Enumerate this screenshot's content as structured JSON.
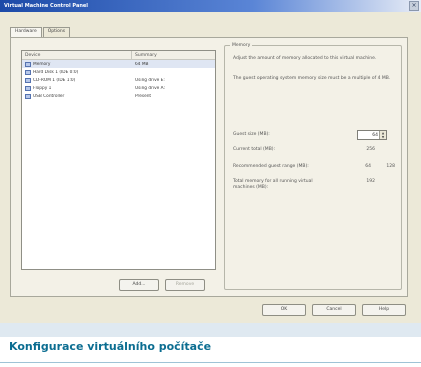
{
  "window": {
    "title": "Virtual Machine Control Panel",
    "close_label": "×"
  },
  "tabs": [
    {
      "label": "Hardware",
      "active": true
    },
    {
      "label": "Options",
      "active": false
    }
  ],
  "device_list": {
    "headers": {
      "device": "Device",
      "summary": "Summary"
    },
    "rows": [
      {
        "device": "Memory",
        "summary": "64 MB",
        "icon": "memory-icon",
        "selected": true
      },
      {
        "device": "Hard Disk 1 (IDE 0:0)",
        "summary": "",
        "icon": "hard-disk-icon",
        "selected": false
      },
      {
        "device": "CD-ROM 1 (IDE 1:0)",
        "summary": "Using drive E:",
        "icon": "cdrom-icon",
        "selected": false
      },
      {
        "device": "Floppy 1",
        "summary": "Using drive A:",
        "icon": "floppy-icon",
        "selected": false
      },
      {
        "device": "USB Controller",
        "summary": "Present",
        "icon": "usb-icon",
        "selected": false
      }
    ]
  },
  "buttons": {
    "add": "Add...",
    "remove": "Remove",
    "ok": "OK",
    "cancel": "Cancel",
    "help": "Help"
  },
  "memory_group": {
    "title": "Memory",
    "desc1": "Adjust the amount of memory allocated to this virtual machine.",
    "desc2": "The guest operating system memory size must be a multiple of 4 MB.",
    "guest_size_label": "Guest size (MB):",
    "guest_size_value": "64",
    "current_label": "Current total (MB):",
    "current_value": "256",
    "recommended_label": "Recommended guest range (MB):",
    "recommended_min": "64",
    "recommended_max": "128",
    "total_label": "Total memory for all running virtual machines (MB):",
    "total_value": "192"
  },
  "caption": "Konfigurace virtuálního počítače",
  "colors": {
    "title_bar": "#1c4aa8",
    "dialog_bg": "#ece9d8",
    "caption_text": "#0b6d91",
    "caption_strip": "#dfe9f1"
  }
}
